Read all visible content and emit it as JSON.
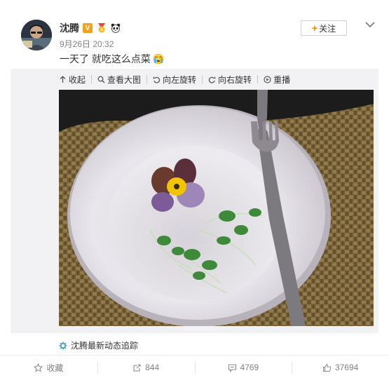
{
  "post": {
    "username": "沈腾",
    "verified_badge": "V",
    "timestamp": "9月26日 20:32",
    "text": "一天了 就吃这么点菜",
    "follow_label": "关注",
    "follow_icon": "+",
    "icons": {
      "verified": "v-badge-icon",
      "medal": "medal-icon",
      "panda": "panda-icon",
      "emoji": "crying-face-icon",
      "menu": "chevron-down-icon"
    }
  },
  "toolbar": {
    "collapse_label": "收起",
    "view_large_label": "查看大图",
    "rotate_left_label": "向左旋转",
    "rotate_right_label": "向右旋转",
    "replay_label": "重播"
  },
  "source": {
    "label": "沈腾最新动态追踪"
  },
  "actions": {
    "favorite_label": "收藏",
    "repost_count": "844",
    "comment_count": "4769",
    "like_count": "37694"
  },
  "colors": {
    "accent": "#ff8200",
    "badge": "#f7a01c",
    "link_icon": "#3a9fb5",
    "text_secondary": "#808080"
  }
}
